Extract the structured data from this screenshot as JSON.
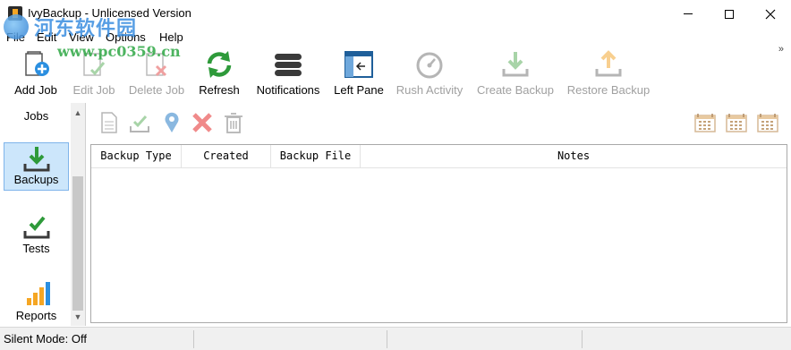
{
  "window": {
    "title": "IvyBackup - Unlicensed Version"
  },
  "watermark": {
    "chinese": "河东软件园",
    "url": "www.pc0359.cn"
  },
  "menu": [
    "File",
    "Edit",
    "View",
    "Options",
    "Help"
  ],
  "toolbar": {
    "overflow_glyph": "»",
    "buttons": [
      {
        "label": "Add Job",
        "enabled": true,
        "icon": "add-job-icon"
      },
      {
        "label": "Edit Job",
        "enabled": false,
        "icon": "edit-job-icon"
      },
      {
        "label": "Delete Job",
        "enabled": false,
        "icon": "delete-job-icon"
      },
      {
        "label": "Refresh",
        "enabled": true,
        "icon": "refresh-icon"
      },
      {
        "label": "Notifications",
        "enabled": true,
        "icon": "notifications-icon"
      },
      {
        "label": "Left Pane",
        "enabled": true,
        "icon": "left-pane-icon"
      },
      {
        "label": "Rush Activity",
        "enabled": false,
        "icon": "rush-activity-icon"
      },
      {
        "label": "Create Backup",
        "enabled": false,
        "icon": "create-backup-icon"
      },
      {
        "label": "Restore Backup",
        "enabled": false,
        "icon": "restore-backup-icon"
      }
    ]
  },
  "sidebar": {
    "items": [
      {
        "label": "Jobs",
        "selected": false
      },
      {
        "label": "Backups",
        "selected": true
      },
      {
        "label": "Tests",
        "selected": false
      },
      {
        "label": "Reports",
        "selected": false
      }
    ]
  },
  "content_toolbar": {
    "left_icons": [
      "document-icon",
      "verify-check-icon",
      "location-pin-icon",
      "delete-x-icon",
      "trash-icon"
    ],
    "right_icons": [
      "calendar-icon",
      "calendar-icon",
      "calendar-icon"
    ]
  },
  "grid": {
    "columns": [
      "Backup Type",
      "Created",
      "Backup File",
      "Notes"
    ],
    "rows": []
  },
  "statusbar": {
    "text": "Silent Mode: Off"
  },
  "colors": {
    "accent_green": "#2e9a3a",
    "selection_bg": "#cce6fb",
    "delete_red": "#e05050",
    "orange": "#f5a623",
    "disabled_text": "#a0a0a0"
  }
}
